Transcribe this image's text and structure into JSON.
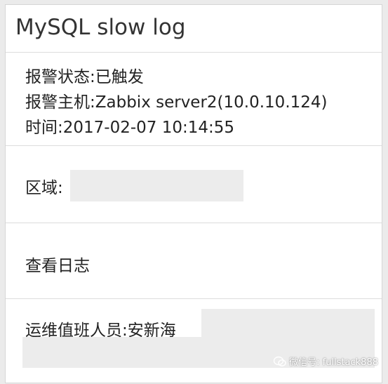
{
  "title": "MySQL slow log",
  "alert": {
    "status": "报警状态:已触发",
    "host": "报警主机:Zabbix server2(10.0.10.124)",
    "time": "时间:2017-02-07 10:14:55"
  },
  "region_label": "区域:",
  "view_logs": "查看日志",
  "oncall_label": "运维值班人员:安新海",
  "watermark": "微信号: fullstack888",
  "colors": {
    "background": "#ebebeb",
    "card": "#ffffff",
    "redaction": "#ececec",
    "divider": "#dcdcdc"
  }
}
